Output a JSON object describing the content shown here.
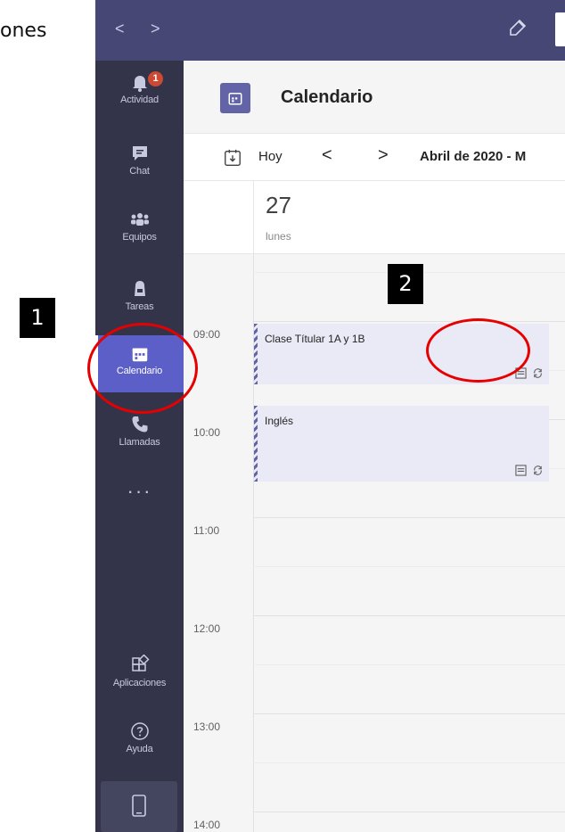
{
  "document": {
    "fragment_text": "ones"
  },
  "topbar": {
    "back_label": "<",
    "forward_label": ">"
  },
  "rail": {
    "items": [
      {
        "label": "Actividad",
        "badge": "1"
      },
      {
        "label": "Chat"
      },
      {
        "label": "Equipos"
      },
      {
        "label": "Tareas"
      },
      {
        "label": "Calendario"
      },
      {
        "label": "Llamadas"
      }
    ],
    "more_label": "···",
    "bottom": [
      {
        "label": "Aplicaciones"
      },
      {
        "label": "Ayuda"
      }
    ]
  },
  "header": {
    "title": "Calendario"
  },
  "toolbar": {
    "today_label": "Hoy",
    "prev_label": "<",
    "next_label": ">",
    "month_label": "Abril de 2020 - M"
  },
  "day": {
    "number": "27",
    "name": "lunes"
  },
  "times": [
    "09:00",
    "10:00",
    "11:00",
    "12:00",
    "13:00",
    "14:00"
  ],
  "events": [
    {
      "title": "Clase Títular 1A y 1B"
    },
    {
      "title": "Inglés"
    }
  ],
  "annotations": {
    "callout_1": "1",
    "callout_2": "2"
  },
  "colors": {
    "rail_bg": "#33344a",
    "topbar_bg": "#464775",
    "accent": "#6264a7",
    "annotation_red": "#e60000"
  }
}
